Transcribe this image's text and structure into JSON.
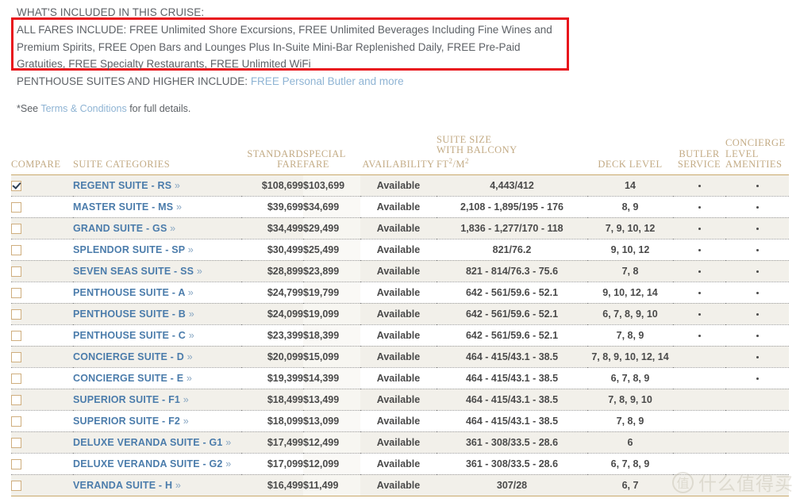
{
  "included": {
    "title": "WHAT'S INCLUDED IN THIS CRUISE:",
    "all_fares_text": "ALL FARES INCLUDE: FREE Unlimited Shore Excursions, FREE Unlimited Beverages Including Fine Wines and Premium Spirits, FREE Open Bars and Lounges Plus In-Suite Mini-Bar Replenished Daily, FREE Pre-Paid Gratuities, FREE Specialty Restaurants, FREE Unlimited WiFi",
    "penthouse_prefix": "PENTHOUSE SUITES AND HIGHER INCLUDE: ",
    "penthouse_link": "FREE Personal Butler and more",
    "terms_prefix": "*See ",
    "terms_link": "Terms & Conditions",
    "terms_suffix": " for full details.",
    "highlight_border_color": "#e8131b"
  },
  "table": {
    "headers": {
      "compare": "COMPARE",
      "categories": "SUITE CATEGORIES",
      "standard_fare_l1": "STANDARD",
      "standard_fare_l2": "FARE",
      "special_fare_l1": "SPECIAL",
      "special_fare_l2": "FARE",
      "availability": "AVAILABILITY",
      "suite_size_l1": "SUITE SIZE",
      "suite_size_l2": "WITH BALCONY",
      "suite_size_l3_a": "FT",
      "suite_size_l3_sup1": "2",
      "suite_size_l3_b": "/M",
      "suite_size_l3_sup2": "2",
      "deck_level": "DECK LEVEL",
      "butler_l1": "BUTLER",
      "butler_l2": "SERVICE",
      "concierge_l1": "CONCIERGE",
      "concierge_l2": "LEVEL",
      "concierge_l3": "AMENITIES"
    },
    "accent_color": "#c9a96b",
    "link_color": "#4b7cab",
    "rows": [
      {
        "checked": true,
        "name": "REGENT SUITE - RS",
        "standard": "$108,699",
        "special": "$103,699",
        "availability": "Available",
        "size": "4,443/412",
        "deck": "14",
        "butler": true,
        "concierge": true
      },
      {
        "checked": false,
        "name": "MASTER SUITE - MS",
        "standard": "$39,699",
        "special": "$34,699",
        "availability": "Available",
        "size": "2,108 - 1,895/195 - 176",
        "deck": "8, 9",
        "butler": true,
        "concierge": true
      },
      {
        "checked": false,
        "name": "GRAND SUITE - GS",
        "standard": "$34,499",
        "special": "$29,499",
        "availability": "Available",
        "size": "1,836 - 1,277/170 - 118",
        "deck": "7, 9, 10, 12",
        "butler": true,
        "concierge": true
      },
      {
        "checked": false,
        "name": "SPLENDOR SUITE - SP",
        "standard": "$30,499",
        "special": "$25,499",
        "availability": "Available",
        "size": "821/76.2",
        "deck": "9, 10, 12",
        "butler": true,
        "concierge": true
      },
      {
        "checked": false,
        "name": "SEVEN SEAS SUITE - SS",
        "standard": "$28,899",
        "special": "$23,899",
        "availability": "Available",
        "size": "821 - 814/76.3 - 75.6",
        "deck": "7, 8",
        "butler": true,
        "concierge": true
      },
      {
        "checked": false,
        "name": "PENTHOUSE SUITE - A",
        "standard": "$24,799",
        "special": "$19,799",
        "availability": "Available",
        "size": "642 - 561/59.6 - 52.1",
        "deck": "9, 10, 12, 14",
        "butler": true,
        "concierge": true
      },
      {
        "checked": false,
        "name": "PENTHOUSE SUITE - B",
        "standard": "$24,099",
        "special": "$19,099",
        "availability": "Available",
        "size": "642 - 561/59.6 - 52.1",
        "deck": "6, 7, 8, 9, 10",
        "butler": true,
        "concierge": true
      },
      {
        "checked": false,
        "name": "PENTHOUSE SUITE - C",
        "standard": "$23,399",
        "special": "$18,399",
        "availability": "Available",
        "size": "642 - 561/59.6 - 52.1",
        "deck": "7, 8, 9",
        "butler": true,
        "concierge": true
      },
      {
        "checked": false,
        "name": "CONCIERGE SUITE - D",
        "standard": "$20,099",
        "special": "$15,099",
        "availability": "Available",
        "size": "464 - 415/43.1 - 38.5",
        "deck": "7, 8, 9, 10, 12, 14",
        "butler": false,
        "concierge": true
      },
      {
        "checked": false,
        "name": "CONCIERGE SUITE - E",
        "standard": "$19,399",
        "special": "$14,399",
        "availability": "Available",
        "size": "464 - 415/43.1 - 38.5",
        "deck": "6, 7, 8, 9",
        "butler": false,
        "concierge": true
      },
      {
        "checked": false,
        "name": "SUPERIOR SUITE - F1",
        "standard": "$18,499",
        "special": "$13,499",
        "availability": "Available",
        "size": "464 - 415/43.1 - 38.5",
        "deck": "7, 8, 9, 10",
        "butler": false,
        "concierge": false
      },
      {
        "checked": false,
        "name": "SUPERIOR SUITE - F2",
        "standard": "$18,099",
        "special": "$13,099",
        "availability": "Available",
        "size": "464 - 415/43.1 - 38.5",
        "deck": "7, 8, 9",
        "butler": false,
        "concierge": false
      },
      {
        "checked": false,
        "name": "DELUXE VERANDA SUITE - G1",
        "standard": "$17,499",
        "special": "$12,499",
        "availability": "Available",
        "size": "361 - 308/33.5 - 28.6",
        "deck": "6",
        "butler": false,
        "concierge": false
      },
      {
        "checked": false,
        "name": "DELUXE VERANDA SUITE - G2",
        "standard": "$17,099",
        "special": "$12,099",
        "availability": "Available",
        "size": "361 - 308/33.5 - 28.6",
        "deck": "6, 7, 8, 9",
        "butler": false,
        "concierge": false
      },
      {
        "checked": false,
        "name": "VERANDA SUITE - H",
        "standard": "$16,499",
        "special": "$11,499",
        "availability": "Available",
        "size": "307/28",
        "deck": "6, 7",
        "butler": false,
        "concierge": false
      }
    ],
    "chevron": "»"
  },
  "watermark": {
    "badge": "值",
    "text": "什么值得买"
  }
}
